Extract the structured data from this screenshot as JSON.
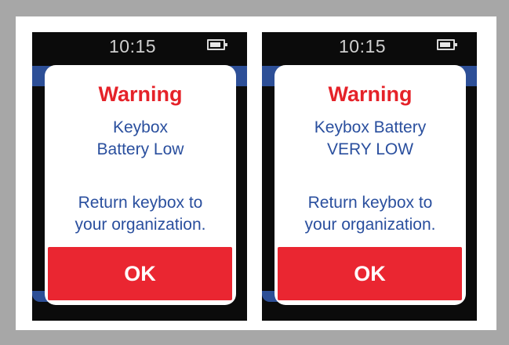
{
  "screens": [
    {
      "clock": "10:15",
      "title": "Warning",
      "message_lines": [
        "Keybox",
        "Battery Low"
      ],
      "instruction_lines": [
        "Return keybox to",
        "your organization."
      ],
      "ok_label": "OK"
    },
    {
      "clock": "10:15",
      "title": "Warning",
      "message_lines": [
        "Keybox Battery",
        "VERY LOW"
      ],
      "instruction_lines": [
        "Return keybox to",
        "your organization."
      ],
      "ok_label": "OK"
    }
  ],
  "icons": {
    "battery": "battery-icon"
  },
  "colors": {
    "warning_red": "#e52229",
    "message_blue": "#2a4f9e",
    "button_red": "#ea2631",
    "screen_background": "#0b0b0b",
    "page_background": "#a7a7a7"
  }
}
